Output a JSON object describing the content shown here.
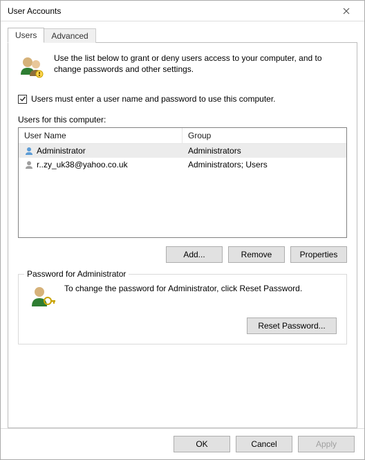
{
  "window": {
    "title": "User Accounts"
  },
  "tabs": {
    "users": "Users",
    "advanced": "Advanced"
  },
  "intro": "Use the list below to grant or deny users access to your computer, and to change passwords and other settings.",
  "require_login": {
    "checked": true,
    "label": "Users must enter a user name and password to use this computer."
  },
  "list_label": "Users for this computer:",
  "columns": {
    "name": "User Name",
    "group": "Group"
  },
  "rows": [
    {
      "name": "Administrator",
      "group": "Administrators",
      "selected": true
    },
    {
      "name": "r..zy_uk38@yahoo.co.uk",
      "group": "Administrators; Users",
      "selected": false
    }
  ],
  "buttons": {
    "add": "Add...",
    "remove": "Remove",
    "properties": "Properties"
  },
  "password_group": {
    "title": "Password for Administrator",
    "text": "To change the password for Administrator, click Reset Password.",
    "reset": "Reset Password..."
  },
  "footer": {
    "ok": "OK",
    "cancel": "Cancel",
    "apply": "Apply"
  }
}
